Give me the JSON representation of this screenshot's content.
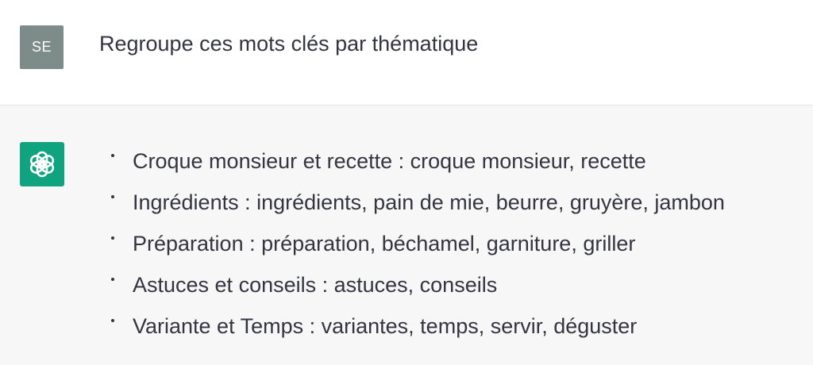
{
  "user": {
    "avatar_initials": "SE",
    "message": "Regroupe ces mots clés par thématique"
  },
  "assistant": {
    "avatar_icon": "openai-logo-icon",
    "items": [
      "Croque monsieur et recette : croque monsieur, recette",
      "Ingrédients : ingrédients, pain de mie, beurre, gruyère, jambon",
      "Préparation : préparation, béchamel, garniture, griller",
      "Astuces et conseils : astuces, conseils",
      "Variante et Temps : variantes, temps, servir, déguster"
    ]
  },
  "colors": {
    "user_bg": "#ffffff",
    "assistant_bg": "#f7f7f8",
    "user_avatar": "#7e8c89",
    "assistant_avatar": "#10a37f",
    "text": "#343541"
  }
}
